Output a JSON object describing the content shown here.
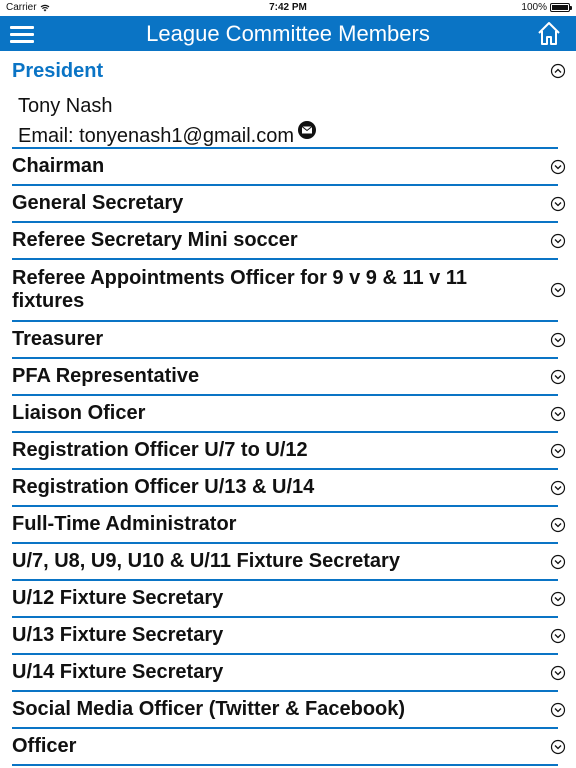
{
  "status_bar": {
    "carrier": "Carrier",
    "time": "7:42 PM",
    "battery": "100%",
    "battery_level": 1.0
  },
  "nav": {
    "title": "League Committee Members",
    "menu_icon": "hamburger-menu-icon",
    "home_icon": "home-icon"
  },
  "president": {
    "title": "President",
    "name": "Tony Nash",
    "email": "Email: tonyenash1@gmail.com",
    "mail_icon": "mail-icon",
    "expanded": true
  },
  "roles": [
    {
      "label": "Chairman"
    },
    {
      "label": "General Secretary"
    },
    {
      "label": "Referee Secretary Mini soccer"
    },
    {
      "label": "Referee Appointments Officer for 9 v 9 & 11 v 11 fixtures"
    },
    {
      "label": "Treasurer"
    },
    {
      "label": "PFA Representative"
    },
    {
      "label": "Liaison Oficer"
    },
    {
      "label": "Registration Officer U/7 to U/12"
    },
    {
      "label": "Registration Officer U/13 & U/14"
    },
    {
      "label": "Full-Time Administrator"
    },
    {
      "label": "U/7, U8, U9, U10 & U/11 Fixture Secretary"
    },
    {
      "label": "U/12 Fixture Secretary"
    },
    {
      "label": "U/13 Fixture Secretary"
    },
    {
      "label": "U/14 Fixture Secretary"
    },
    {
      "label": "Social Media Officer (Twitter & Facebook)"
    },
    {
      "label": "Officer"
    }
  ],
  "colors": {
    "accent": "#0a74c5",
    "text": "#111111",
    "background": "#ffffff"
  }
}
